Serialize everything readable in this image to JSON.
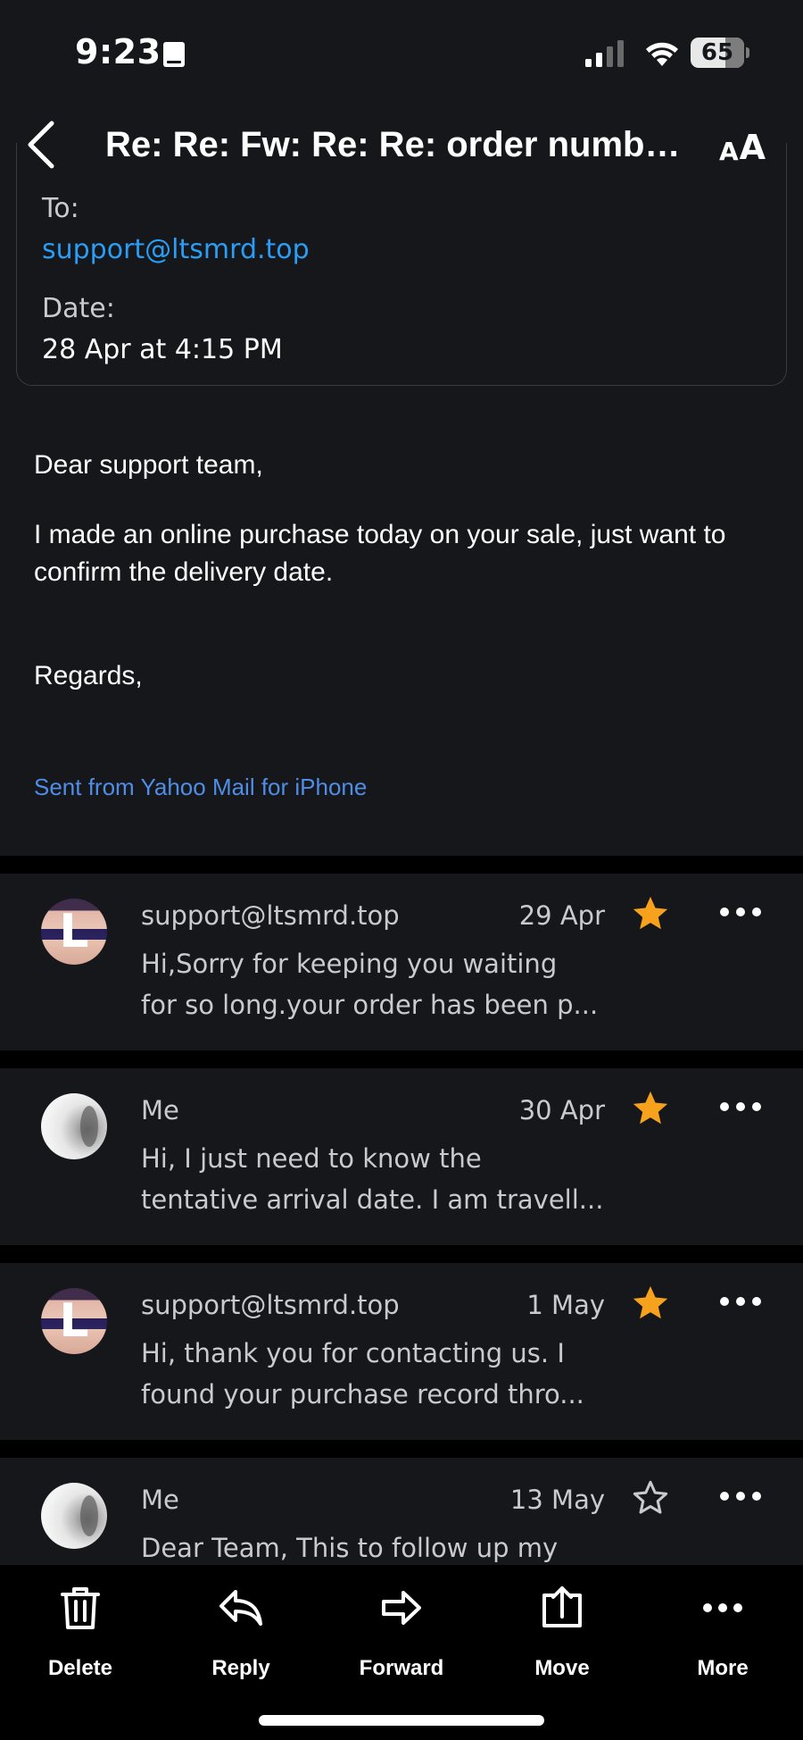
{
  "status_bar": {
    "time": "9:23",
    "battery_level": "65",
    "battery_fraction": 0.65
  },
  "header": {
    "title": "Re: Re: Fw: Re: Re: order number...",
    "back_icon": "chevron-left-icon",
    "text_size_icon": "text-size-icon"
  },
  "details": {
    "to_label": "To:",
    "to_value": "support@ltsmrd.top",
    "date_label": "Date:",
    "date_value": "28 Apr at 4:15 PM"
  },
  "message": {
    "greeting": "Dear support team,",
    "text": "I made an online purchase today on your sale, just want to confirm the delivery date.",
    "regards": "Regards,",
    "signature": "Sent from Yahoo Mail for iPhone"
  },
  "thread": [
    {
      "sender": "support@ltsmrd.top",
      "date": "29 Apr",
      "starred": true,
      "avatar": "L",
      "preview_line1": "Hi,Sorry for keeping you waiting",
      "preview_line2": "for so long.your order has been p..."
    },
    {
      "sender": "Me",
      "date": "30 Apr",
      "starred": true,
      "avatar": "",
      "preview_line1": "Hi, I just need to know the",
      "preview_line2": "tentative arrival date. I am travell..."
    },
    {
      "sender": "support@ltsmrd.top",
      "date": "1 May",
      "starred": true,
      "avatar": "L",
      "preview_line1": "Hi, thank you for contacting us. I",
      "preview_line2": "found your purchase record thro..."
    },
    {
      "sender": "Me",
      "date": "13 May",
      "starred": false,
      "avatar": "",
      "preview_line1": "Dear Team, This to follow up my",
      "preview_line2": ""
    }
  ],
  "toolbar": {
    "delete": "Delete",
    "reply": "Reply",
    "forward": "Forward",
    "move": "Move",
    "more": "More"
  },
  "colors": {
    "background": "#16171b",
    "link": "#2a9df4",
    "signature_link": "#4f8de6",
    "star": "#f6a21c"
  }
}
